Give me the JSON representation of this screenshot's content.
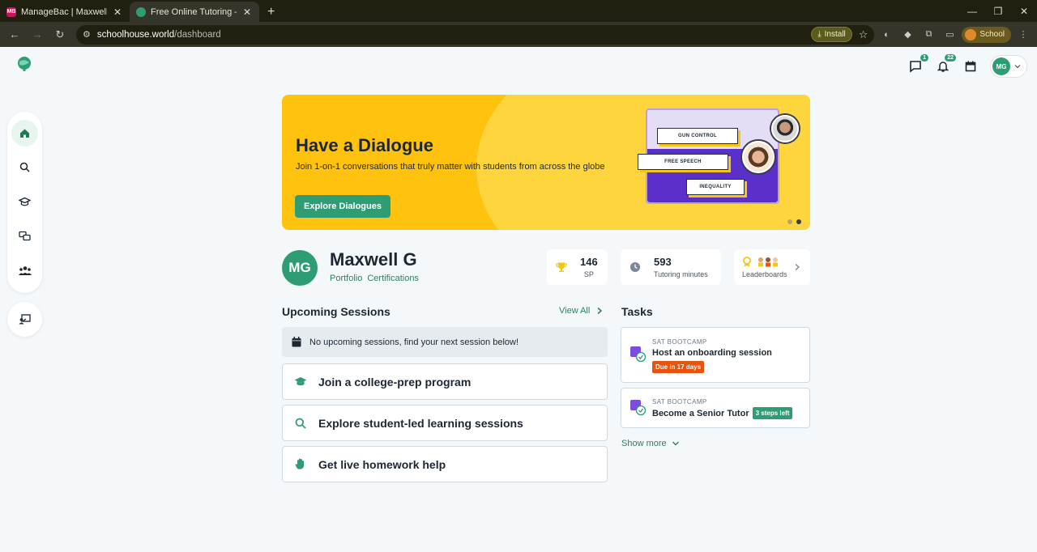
{
  "browser": {
    "tabs": [
      {
        "title": "ManageBac | Maxwell Grace",
        "favicon_text": "MB",
        "favicon_color": "#c2185b"
      },
      {
        "title": "Free Online Tutoring — Schoolh",
        "favicon_text": "",
        "favicon_color": "#2e9d74"
      }
    ],
    "url_host": "schoolhouse.world",
    "url_path": "/dashboard",
    "install_label": "Install",
    "profile_label": "School"
  },
  "header": {
    "messages_badge": "1",
    "notifications_badge": "22",
    "avatar_initials": "MG"
  },
  "banner": {
    "title": "Have a Dialogue",
    "subtitle": "Join 1-on-1 conversations that truly matter with students from across the globe",
    "button_label": "Explore Dialogues",
    "tags": [
      "GUN CONTROL",
      "FREE SPEECH",
      "INEQUALITY"
    ]
  },
  "profile": {
    "initials": "MG",
    "name": "Maxwell G",
    "links": [
      "Portfolio",
      "Certifications"
    ]
  },
  "stats": {
    "sp_value": "146",
    "sp_label": "SP",
    "minutes_value": "593",
    "minutes_label": "Tutoring minutes",
    "leaderboards_label": "Leaderboards"
  },
  "sessions": {
    "title": "Upcoming Sessions",
    "view_all": "View All",
    "empty_text": "No upcoming sessions, find your next session below!",
    "actions": [
      {
        "label": "Join a college-prep program",
        "icon": "graduation-cap-icon"
      },
      {
        "label": "Explore student-led learning sessions",
        "icon": "search-icon"
      },
      {
        "label": "Get live homework help",
        "icon": "raised-hand-icon"
      }
    ]
  },
  "tasks": {
    "title": "Tasks",
    "items": [
      {
        "program": "SAT BOOTCAMP",
        "name": "Host an onboarding session",
        "badge": "Due in 17 days"
      },
      {
        "program": "SAT BOOTCAMP",
        "name": "Become a Senior Tutor",
        "badge": "3 steps left"
      }
    ],
    "show_more": "Show more"
  },
  "colors": {
    "brand_green": "#2e9d74",
    "banner_yellow": "#ffc20e",
    "due_orange": "#e8530d"
  }
}
